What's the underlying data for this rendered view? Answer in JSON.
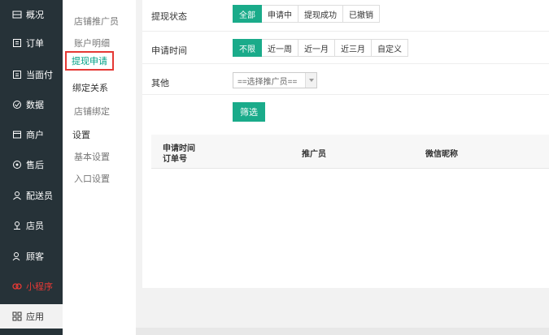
{
  "sidebar": {
    "items": [
      {
        "label": "概况",
        "icon": "overview-icon"
      },
      {
        "label": "订单",
        "icon": "order-icon"
      },
      {
        "label": "当面付",
        "icon": "pay-icon"
      },
      {
        "label": "数据",
        "icon": "data-icon"
      },
      {
        "label": "商户",
        "icon": "shop-icon"
      },
      {
        "label": "售后",
        "icon": "aftersale-icon"
      },
      {
        "label": "配送员",
        "icon": "courier-icon"
      },
      {
        "label": "店员",
        "icon": "staff-icon"
      },
      {
        "label": "顾客",
        "icon": "customer-icon"
      },
      {
        "label": "小程序",
        "icon": "miniprogram-icon"
      },
      {
        "label": "应用",
        "icon": "apps-icon"
      }
    ]
  },
  "subnav": {
    "items": [
      "店铺推广员",
      "账户明细",
      "提现申请",
      "绑定关系",
      "店铺绑定"
    ],
    "settings_head": "设置",
    "settings_items": [
      "基本设置",
      "入口设置"
    ]
  },
  "filters": {
    "status_label": "提现状态",
    "status_options": [
      "全部",
      "申请中",
      "提现成功",
      "已撤销"
    ],
    "time_label": "申请时间",
    "time_options": [
      "不限",
      "近一周",
      "近一月",
      "近三月",
      "自定义"
    ],
    "other_label": "其他",
    "promoter_select": "==选择推广员==",
    "filter_button": "筛选"
  },
  "table": {
    "col1_line1": "申请时间",
    "col1_line2": "订单号",
    "col2": "推广员",
    "col3": "微信昵称"
  },
  "colors": {
    "sidebar_bg": "#263238",
    "accent": "#1aab8a",
    "highlight": "#e53935"
  }
}
